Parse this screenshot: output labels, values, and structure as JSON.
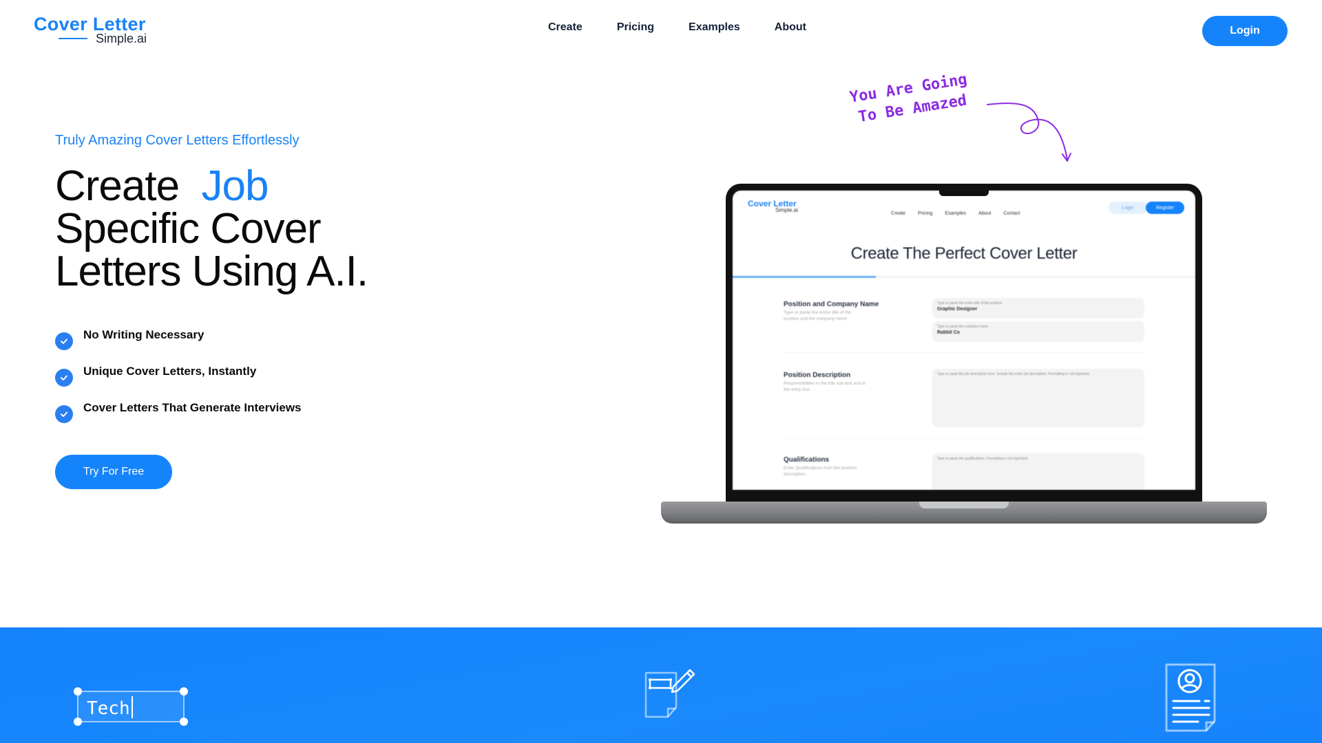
{
  "header": {
    "logo_top": "Cover Letter",
    "logo_bottom": "Simple.ai",
    "nav": [
      {
        "label": "Create"
      },
      {
        "label": "Pricing"
      },
      {
        "label": "Examples"
      },
      {
        "label": "About"
      }
    ],
    "login_label": "Login"
  },
  "hero": {
    "eyebrow": "Truly Amazing Cover Letters Effortlessly",
    "title_line1_a": "Create",
    "title_line1_accent": "Job",
    "title_line2": "Specific Cover",
    "title_line3": "Letters Using A.I.",
    "features": [
      {
        "icon": "check-circle-icon",
        "label": "No Writing Necessary"
      },
      {
        "icon": "check-circle-icon",
        "label": "Unique Cover Letters, Instantly"
      },
      {
        "icon": "check-circle-icon",
        "label": "Cover Letters That Generate Interviews"
      }
    ],
    "cta_label": "Try For Free"
  },
  "annotation": {
    "line1": "You Are Going",
    "line2": "To Be Amazed",
    "color": "#8a2be2"
  },
  "mockup": {
    "logo_top": "Cover Letter",
    "logo_bottom": "Simple.ai",
    "nav": [
      "Create",
      "Pricing",
      "Examples",
      "About",
      "Contact"
    ],
    "login_label": "Login",
    "register_label": "Register",
    "title": "Create The Perfect Cover Letter",
    "progress": 0.31,
    "sections": [
      {
        "heading": "Position and Company Name",
        "sub": "Type or paste the entire title of the position and the company name",
        "fields": [
          {
            "placeholder": "Type or paste the entire title of the position",
            "value": "Graphic Designer"
          },
          {
            "placeholder": "Type or paste the company name",
            "value": "Rabbit Co"
          }
        ]
      },
      {
        "heading": "Position Description",
        "sub": "Responsibilities in the title sub-text and in the entry box.",
        "fields": [
          {
            "placeholder": "Type or paste the job description here. Include the entire job description. Formatting is not important.",
            "value": ""
          }
        ]
      },
      {
        "heading": "Qualifications",
        "sub": "Enter Qualifications from the position description.",
        "fields": [
          {
            "placeholder": "Type or paste the qualifications. Formatting is not important.",
            "value": ""
          }
        ]
      }
    ]
  },
  "band": {
    "tech_text": "Tech",
    "icons": [
      "text-box-icon",
      "document-edit-icon",
      "resume-icon"
    ]
  },
  "colors": {
    "brand": "#1584fb",
    "accent_text": "#1a82f5",
    "annotation": "#8a2be2"
  }
}
